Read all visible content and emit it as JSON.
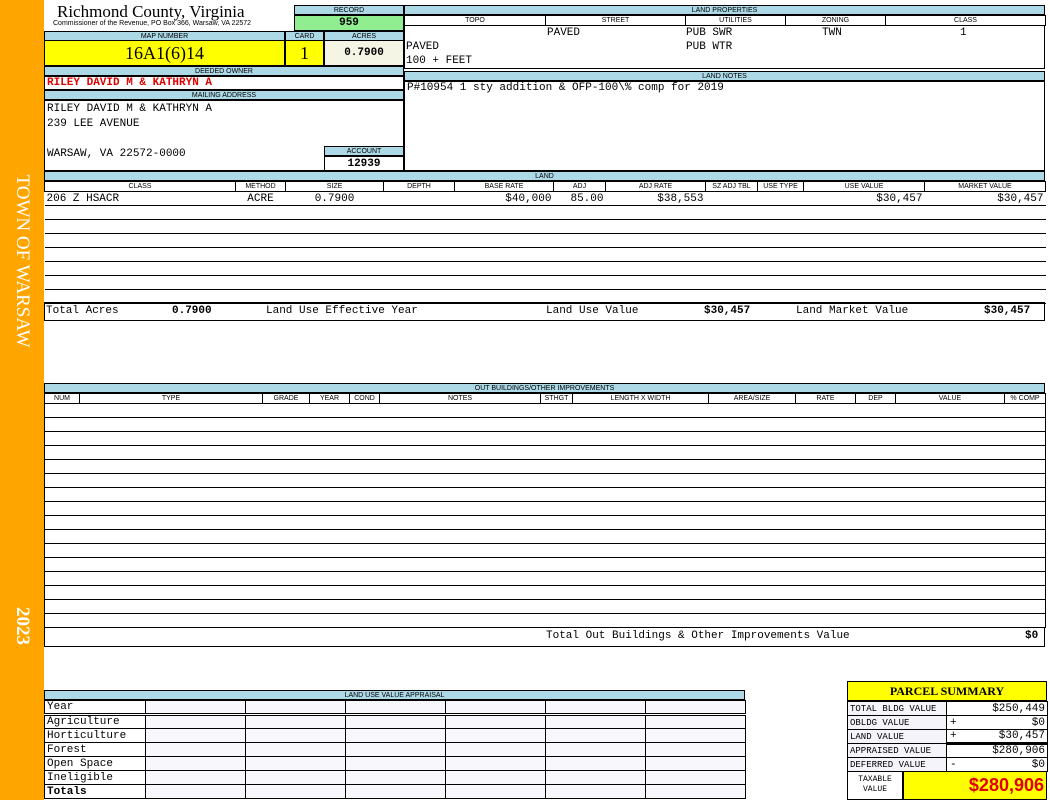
{
  "sidebar": {
    "town": "TOWN OF WARSAW",
    "year": "2023",
    "color": "#ffa500"
  },
  "header": {
    "title": "Richmond County, Virginia",
    "subtitle": "Commissioner of the Revenue, PO Box 366, Warsaw, VA 22572"
  },
  "record": {
    "label": "RECORD",
    "value": "959"
  },
  "map": {
    "map_label": "MAP NUMBER",
    "map_value": "16A1(6)14",
    "card_label": "CARD",
    "card_value": "1",
    "acres_label": "ACRES",
    "acres_value": "0.7900"
  },
  "owner": {
    "label": "DEEDED OWNER",
    "value": "RILEY DAVID M & KATHRYN A"
  },
  "mailing": {
    "label": "MAILING ADDRESS",
    "line1": "RILEY DAVID M & KATHRYN A",
    "line2": "239 LEE AVENUE",
    "line3": "WARSAW, VA 22572-0000"
  },
  "account": {
    "label": "ACCOUNT",
    "value": "12939"
  },
  "land_properties": {
    "label": "LAND PROPERTIES",
    "columns": [
      "TOPO",
      "STREET",
      "UTILITIES",
      "ZONING",
      "CLASS"
    ],
    "street": "PAVED",
    "util1": "PUB SWR",
    "util2": "PUB WTR",
    "zoning": "TWN",
    "class": "1",
    "topo1": "PAVED",
    "topo2": "100 + FEET"
  },
  "land_notes": {
    "label": "LAND NOTES",
    "text": "P#10954 1 sty addition & OFP-100\\% comp for 2019"
  },
  "land": {
    "label": "LAND",
    "columns": [
      "CLASS",
      "METHOD",
      "SIZE",
      "DEPTH",
      "BASE RATE",
      "ADJ",
      "ADJ RATE",
      "SZ ADJ TBL",
      "USE TYPE",
      "USE VALUE",
      "MARKET VALUE"
    ],
    "rows": [
      [
        "206 Z HSACR",
        "ACRE",
        "0.7900",
        "",
        "$40,000",
        "85.00",
        "$38,553",
        "",
        "",
        "$30,457",
        "$30,457"
      ]
    ],
    "total_acres_label": "Total Acres",
    "total_acres": "0.7900",
    "effective_year_label": "Land Use Effective Year",
    "use_value_label": "Land Use Value",
    "use_value": "$30,457",
    "market_value_label": "Land Market Value",
    "market_value": "$30,457"
  },
  "outbuildings": {
    "label": "OUT BUILDINGS/OTHER IMPROVEMENTS",
    "columns": [
      "NUM",
      "TYPE",
      "GRADE",
      "YEAR",
      "COND",
      "NOTES",
      "STHGT",
      "LENGTH X WIDTH",
      "AREA/SIZE",
      "RATE",
      "DEP",
      "VALUE",
      "% COMP"
    ],
    "total_label": "Total Out Buildings & Other Improvements Value",
    "total": "$0"
  },
  "land_use": {
    "label": "LAND USE VALUE APPRAISAL",
    "rows": [
      "Year",
      "Agriculture",
      "Horticulture",
      "Forest",
      "Open Space",
      "Ineligible",
      "Totals"
    ]
  },
  "parcel_summary": {
    "title": "PARCEL SUMMARY",
    "rows": [
      {
        "label": "TOTAL BLDG VALUE",
        "sign": "",
        "value": "$250,449"
      },
      {
        "label": "OBLDG VALUE",
        "sign": "+",
        "value": "$0"
      },
      {
        "label": "LAND VALUE",
        "sign": "+",
        "value": "$30,457"
      },
      {
        "label": "APPRAISED VALUE",
        "sign": "",
        "value": "$280,906"
      },
      {
        "label": "DEFERRED VALUE",
        "sign": "-",
        "value": "$0"
      }
    ],
    "taxable_label": "TAXABLE VALUE",
    "taxable_value": "$280,906"
  }
}
